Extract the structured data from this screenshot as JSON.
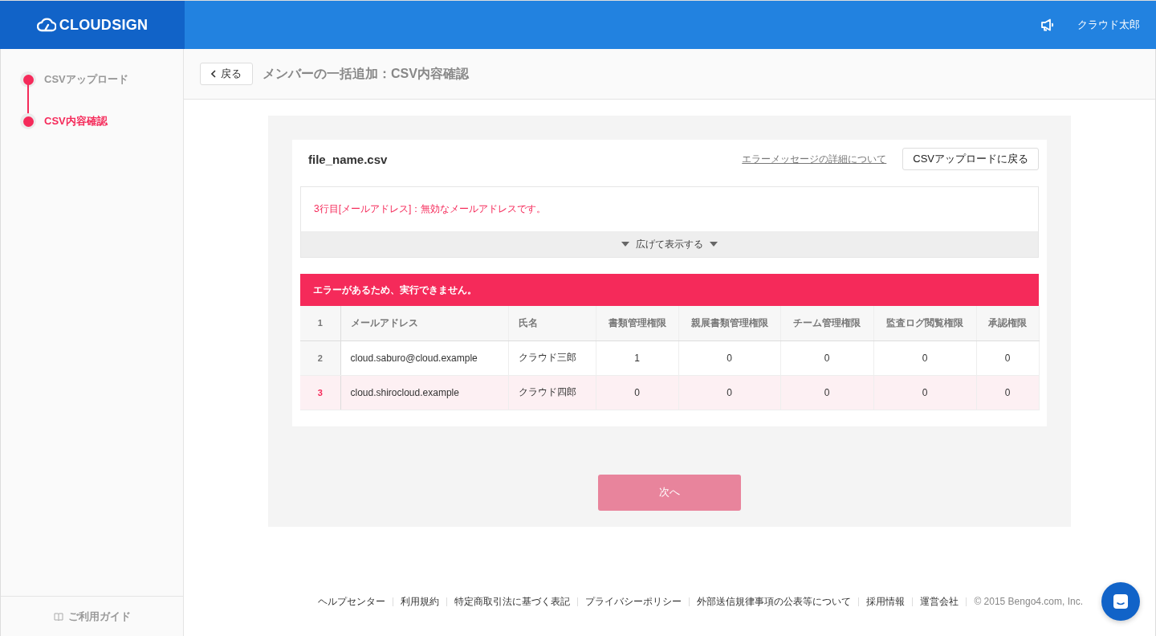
{
  "header": {
    "logo": "CLOUDSIGN",
    "user": "クラウド太郎"
  },
  "steps": [
    {
      "label": "CSVアップロード",
      "selected": false
    },
    {
      "label": "CSV内容確認",
      "selected": true
    }
  ],
  "sidebar_footer": {
    "label": "ご利用ガイド"
  },
  "title_bar": {
    "back_button": "戻る",
    "title": "メンバーの一括追加：CSV内容確認"
  },
  "file": {
    "name": "file_name.csv",
    "help_link": "エラーメッセージの詳細について",
    "back_button": "CSVアップロードに戻る"
  },
  "errors": {
    "messages": [
      "3行目[メールアドレス]：無効なメールアドレスです。"
    ],
    "expand_label": "広げて表示する",
    "expanded": false
  },
  "alert": "エラーがあるため、実行できません。",
  "table": {
    "columns": [
      "1",
      "メールアドレス",
      "氏名",
      "書類管理権限",
      "親展書類管理権限",
      "チーム管理権限",
      "監査ログ閲覧権限",
      "承認権限"
    ],
    "rows": [
      {
        "cells": [
          "2",
          "cloud.saburo@cloud.example",
          "クラウド三郎",
          "1",
          "0",
          "0",
          "0",
          "0"
        ],
        "error": false
      },
      {
        "cells": [
          "3",
          "cloud.shirocloud.example",
          "クラウド四郎",
          "0",
          "0",
          "0",
          "0",
          "0"
        ],
        "error": true
      }
    ]
  },
  "next_button": {
    "label": "次へ",
    "disabled": true
  },
  "footer": {
    "links": [
      "ヘルプセンター",
      "利用規約",
      "特定商取引法に基づく表記",
      "プライバシーポリシー",
      "外部送信規律事項の公表等について",
      "採用情報",
      "運営会社"
    ],
    "copyright": "© 2015 Bengo4.com, Inc."
  }
}
